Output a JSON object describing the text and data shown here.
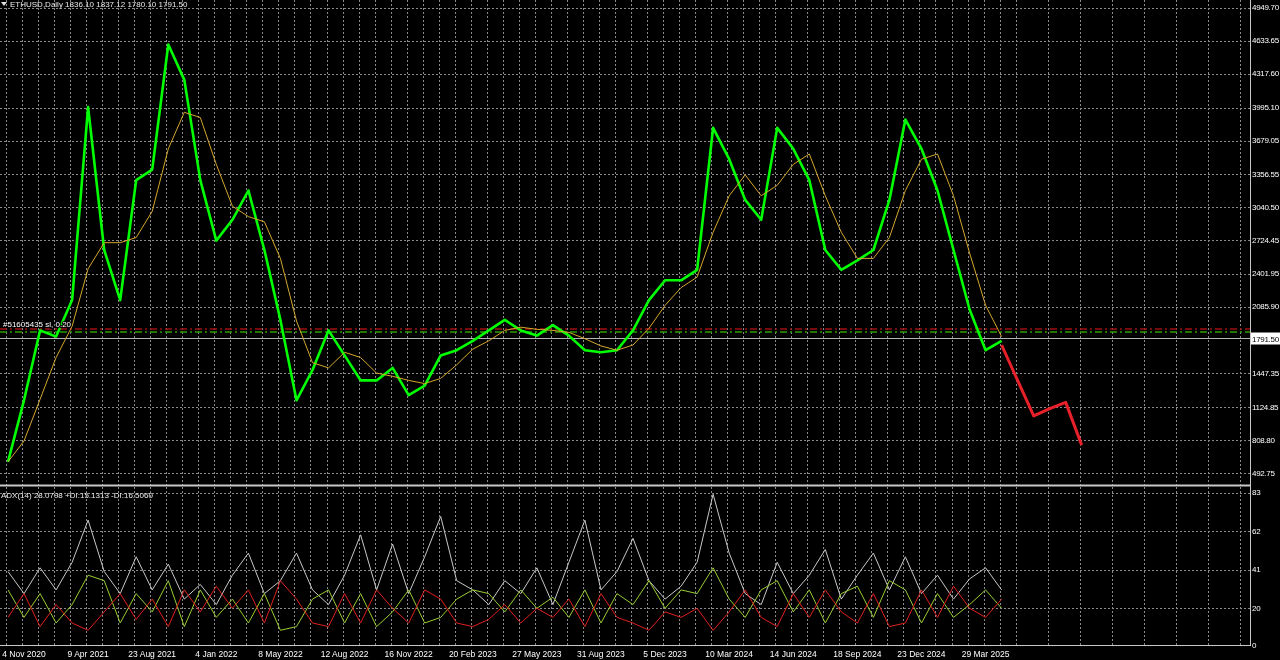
{
  "price_chart": {
    "chart_data": {
      "type": "line",
      "title": "ETHUSD,Daily 1836.10 1837.12 1780.10 1791.50",
      "grid": true,
      "categories": [
        null,
        null,
        null,
        null,
        null,
        null,
        null,
        null,
        null,
        null,
        null,
        null,
        null,
        null,
        null,
        null,
        null,
        null,
        null,
        null,
        null,
        null,
        null,
        null,
        null,
        null,
        null,
        null,
        null,
        null,
        null,
        null,
        null,
        null,
        null,
        null,
        null,
        null,
        null,
        null,
        null,
        null,
        null,
        null,
        null,
        null,
        null,
        null,
        null,
        null,
        null,
        null,
        null,
        null,
        null,
        null,
        null,
        null,
        null,
        null,
        null,
        null,
        null,
        null,
        null,
        null,
        null,
        null,
        null,
        null,
        null,
        null,
        null,
        null,
        null,
        null,
        null,
        null
      ],
      "ylim": [
        378,
        5026
      ],
      "yticks": [
        {
          "value": 4949.7,
          "label": "4949.70"
        },
        {
          "value": 4633.65,
          "label": "4633.65"
        },
        {
          "value": 4317.6,
          "label": "4317.60"
        },
        {
          "value": 3995.1,
          "label": "3995.10"
        },
        {
          "value": 3679.05,
          "label": "3679.05"
        },
        {
          "value": 3356.55,
          "label": "3356.55"
        },
        {
          "value": 3040.5,
          "label": "3040.50"
        },
        {
          "value": 2724.45,
          "label": "2724.45"
        },
        {
          "value": 2401.95,
          "label": "2401.95"
        },
        {
          "value": 2085.9,
          "label": "2085.90"
        },
        {
          "value": 1447.35,
          "label": "1447.35"
        },
        {
          "value": 1124.85,
          "label": "1124.85"
        },
        {
          "value": 808.8,
          "label": "808.80"
        },
        {
          "value": 492.75,
          "label": "492.75"
        }
      ],
      "series": [
        {
          "color": "#00ff00",
          "values": [
            600,
            1190,
            1860,
            1800,
            2150,
            4000,
            2630,
            2150,
            3300,
            3400,
            4600,
            4260,
            3300,
            2720,
            2920,
            3200,
            2630,
            1960,
            1190,
            1480,
            1860,
            1620,
            1380,
            1380,
            1500,
            1240,
            1330,
            1620,
            1670,
            1760,
            1860,
            1960,
            1860,
            1810,
            1910,
            1810,
            1670,
            1650,
            1670,
            1860,
            2150,
            2340,
            2340,
            2440,
            3800,
            3500,
            3110,
            2920,
            3800,
            3600,
            3300,
            2630,
            2440,
            2530,
            2630,
            3110,
            3880,
            3600,
            3200,
            2630,
            2060,
            1670,
            1760,
            null,
            null,
            null,
            null,
            null,
            null,
            null,
            null,
            null,
            null,
            null,
            null,
            null,
            null,
            null
          ]
        },
        {
          "color": "#d4a72c",
          "values": [
            600,
            800,
            1200,
            1600,
            1900,
            2450,
            2700,
            2700,
            2750,
            3000,
            3600,
            3950,
            3900,
            3450,
            3050,
            2950,
            2900,
            2550,
            1950,
            1550,
            1500,
            1650,
            1600,
            1450,
            1420,
            1380,
            1350,
            1400,
            1530,
            1680,
            1760,
            1860,
            1890,
            1870,
            1860,
            1840,
            1780,
            1710,
            1670,
            1720,
            1880,
            2100,
            2270,
            2370,
            2800,
            3150,
            3350,
            3150,
            3250,
            3450,
            3550,
            3150,
            2800,
            2550,
            2550,
            2750,
            3200,
            3500,
            3550,
            3150,
            2600,
            2100,
            1800,
            null,
            null,
            null,
            null,
            null,
            null,
            null,
            null,
            null,
            null,
            null,
            null,
            null,
            null,
            null
          ]
        },
        {
          "color": "#e8202a",
          "values": [
            null,
            null,
            null,
            null,
            null,
            null,
            null,
            null,
            null,
            null,
            null,
            null,
            null,
            null,
            null,
            null,
            null,
            null,
            null,
            null,
            null,
            null,
            null,
            null,
            null,
            null,
            null,
            null,
            null,
            null,
            null,
            null,
            null,
            null,
            null,
            null,
            null,
            null,
            null,
            null,
            null,
            null,
            null,
            null,
            null,
            null,
            null,
            null,
            null,
            null,
            null,
            null,
            null,
            null,
            null,
            null,
            null,
            null,
            null,
            null,
            null,
            null,
            1720,
            1380,
            1040,
            1110,
            1170,
            760,
            null,
            null,
            null,
            null,
            null,
            null,
            null,
            null,
            null,
            null
          ]
        }
      ],
      "ref_lines": [
        {
          "axis": "y",
          "value": 1873,
          "color": "#a01010"
        },
        {
          "axis": "y",
          "value": 1844,
          "color": "#2e9a00"
        },
        {
          "axis": "y",
          "value": 1791.5,
          "color": "#b4b4b4",
          "label": "1791.50"
        }
      ],
      "annotations": [
        "#51605435 sl, 0.20"
      ]
    }
  },
  "indicator_chart": {
    "chart_data": {
      "type": "line",
      "title": "ADX(14) 28.0798 +DI:15.1313 -DI:16.5060",
      "grid": true,
      "categories": [
        null,
        "4 Nov 2020",
        null,
        null,
        null,
        "9 Apr 2021",
        null,
        null,
        null,
        "23 Aug 2021",
        null,
        null,
        null,
        "4 Jan 2022",
        null,
        null,
        null,
        "8 May 2022",
        null,
        null,
        null,
        "12 Aug 2022",
        null,
        null,
        null,
        "16 Nov 2022",
        null,
        null,
        null,
        "20 Feb 2023",
        null,
        null,
        null,
        "27 May 2023",
        null,
        null,
        null,
        "31 Aug 2023",
        null,
        null,
        null,
        "5 Dec 2023",
        null,
        null,
        null,
        "10 Mar 2024",
        null,
        null,
        null,
        "14 Jun 2024",
        null,
        null,
        null,
        "18 Sep 2024",
        null,
        null,
        null,
        "23 Dec 2024",
        null,
        null,
        null,
        "29 Mar 2025",
        null,
        null,
        null,
        null,
        null,
        null,
        null,
        null,
        null,
        null,
        null,
        null,
        null,
        null,
        null,
        null
      ],
      "ylim": [
        0,
        86
      ],
      "yticks": [
        0,
        20,
        41,
        62,
        83
      ],
      "series": [
        {
          "color": "#c8c8c8",
          "values": [
            40,
            28,
            42,
            30,
            45,
            68,
            40,
            28,
            48,
            30,
            44,
            25,
            33,
            22,
            38,
            50,
            28,
            35,
            50,
            30,
            22,
            38,
            60,
            30,
            55,
            28,
            48,
            70,
            35,
            30,
            22,
            35,
            28,
            42,
            22,
            45,
            68,
            30,
            40,
            58,
            35,
            25,
            32,
            45,
            82,
            50,
            28,
            22,
            45,
            28,
            38,
            52,
            25,
            38,
            50,
            30,
            48,
            28,
            38,
            25,
            36,
            42,
            30,
            null,
            null,
            null,
            null,
            null,
            null,
            null,
            null,
            null,
            null,
            null,
            null,
            null,
            null,
            null
          ]
        },
        {
          "color": "#9acd32",
          "values": [
            30,
            15,
            28,
            12,
            22,
            38,
            35,
            12,
            28,
            18,
            35,
            10,
            30,
            15,
            25,
            12,
            28,
            8,
            10,
            25,
            30,
            12,
            28,
            10,
            18,
            30,
            12,
            15,
            25,
            30,
            28,
            18,
            30,
            20,
            26,
            15,
            30,
            12,
            28,
            22,
            35,
            20,
            30,
            28,
            42,
            25,
            15,
            30,
            35,
            18,
            30,
            12,
            28,
            32,
            15,
            35,
            30,
            12,
            28,
            15,
            22,
            30,
            20,
            null,
            null,
            null,
            null,
            null,
            null,
            null,
            null,
            null,
            null,
            null,
            null,
            null,
            null,
            null
          ]
        },
        {
          "color": "#e0201c",
          "values": [
            15,
            28,
            10,
            22,
            12,
            8,
            18,
            28,
            14,
            25,
            10,
            30,
            18,
            32,
            20,
            30,
            12,
            35,
            25,
            12,
            10,
            28,
            12,
            30,
            20,
            12,
            30,
            25,
            12,
            10,
            14,
            22,
            12,
            20,
            15,
            25,
            10,
            28,
            15,
            12,
            8,
            18,
            15,
            20,
            8,
            18,
            30,
            15,
            10,
            28,
            15,
            30,
            18,
            12,
            28,
            10,
            12,
            30,
            15,
            32,
            20,
            15,
            25,
            null,
            null,
            null,
            null,
            null,
            null,
            null,
            null,
            null,
            null,
            null,
            null,
            null,
            null,
            null
          ]
        }
      ]
    }
  }
}
